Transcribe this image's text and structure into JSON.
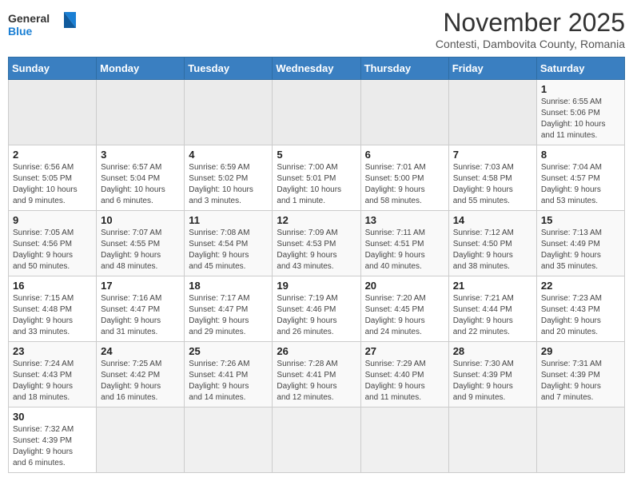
{
  "logo": {
    "text_general": "General",
    "text_blue": "Blue"
  },
  "title": "November 2025",
  "subtitle": "Contesti, Dambovita County, Romania",
  "headers": [
    "Sunday",
    "Monday",
    "Tuesday",
    "Wednesday",
    "Thursday",
    "Friday",
    "Saturday"
  ],
  "weeks": [
    [
      {
        "day": "",
        "info": ""
      },
      {
        "day": "",
        "info": ""
      },
      {
        "day": "",
        "info": ""
      },
      {
        "day": "",
        "info": ""
      },
      {
        "day": "",
        "info": ""
      },
      {
        "day": "",
        "info": ""
      },
      {
        "day": "1",
        "info": "Sunrise: 6:55 AM\nSunset: 5:06 PM\nDaylight: 10 hours\nand 11 minutes."
      }
    ],
    [
      {
        "day": "2",
        "info": "Sunrise: 6:56 AM\nSunset: 5:05 PM\nDaylight: 10 hours\nand 9 minutes."
      },
      {
        "day": "3",
        "info": "Sunrise: 6:57 AM\nSunset: 5:04 PM\nDaylight: 10 hours\nand 6 minutes."
      },
      {
        "day": "4",
        "info": "Sunrise: 6:59 AM\nSunset: 5:02 PM\nDaylight: 10 hours\nand 3 minutes."
      },
      {
        "day": "5",
        "info": "Sunrise: 7:00 AM\nSunset: 5:01 PM\nDaylight: 10 hours\nand 1 minute."
      },
      {
        "day": "6",
        "info": "Sunrise: 7:01 AM\nSunset: 5:00 PM\nDaylight: 9 hours\nand 58 minutes."
      },
      {
        "day": "7",
        "info": "Sunrise: 7:03 AM\nSunset: 4:58 PM\nDaylight: 9 hours\nand 55 minutes."
      },
      {
        "day": "8",
        "info": "Sunrise: 7:04 AM\nSunset: 4:57 PM\nDaylight: 9 hours\nand 53 minutes."
      }
    ],
    [
      {
        "day": "9",
        "info": "Sunrise: 7:05 AM\nSunset: 4:56 PM\nDaylight: 9 hours\nand 50 minutes."
      },
      {
        "day": "10",
        "info": "Sunrise: 7:07 AM\nSunset: 4:55 PM\nDaylight: 9 hours\nand 48 minutes."
      },
      {
        "day": "11",
        "info": "Sunrise: 7:08 AM\nSunset: 4:54 PM\nDaylight: 9 hours\nand 45 minutes."
      },
      {
        "day": "12",
        "info": "Sunrise: 7:09 AM\nSunset: 4:53 PM\nDaylight: 9 hours\nand 43 minutes."
      },
      {
        "day": "13",
        "info": "Sunrise: 7:11 AM\nSunset: 4:51 PM\nDaylight: 9 hours\nand 40 minutes."
      },
      {
        "day": "14",
        "info": "Sunrise: 7:12 AM\nSunset: 4:50 PM\nDaylight: 9 hours\nand 38 minutes."
      },
      {
        "day": "15",
        "info": "Sunrise: 7:13 AM\nSunset: 4:49 PM\nDaylight: 9 hours\nand 35 minutes."
      }
    ],
    [
      {
        "day": "16",
        "info": "Sunrise: 7:15 AM\nSunset: 4:48 PM\nDaylight: 9 hours\nand 33 minutes."
      },
      {
        "day": "17",
        "info": "Sunrise: 7:16 AM\nSunset: 4:47 PM\nDaylight: 9 hours\nand 31 minutes."
      },
      {
        "day": "18",
        "info": "Sunrise: 7:17 AM\nSunset: 4:47 PM\nDaylight: 9 hours\nand 29 minutes."
      },
      {
        "day": "19",
        "info": "Sunrise: 7:19 AM\nSunset: 4:46 PM\nDaylight: 9 hours\nand 26 minutes."
      },
      {
        "day": "20",
        "info": "Sunrise: 7:20 AM\nSunset: 4:45 PM\nDaylight: 9 hours\nand 24 minutes."
      },
      {
        "day": "21",
        "info": "Sunrise: 7:21 AM\nSunset: 4:44 PM\nDaylight: 9 hours\nand 22 minutes."
      },
      {
        "day": "22",
        "info": "Sunrise: 7:23 AM\nSunset: 4:43 PM\nDaylight: 9 hours\nand 20 minutes."
      }
    ],
    [
      {
        "day": "23",
        "info": "Sunrise: 7:24 AM\nSunset: 4:43 PM\nDaylight: 9 hours\nand 18 minutes."
      },
      {
        "day": "24",
        "info": "Sunrise: 7:25 AM\nSunset: 4:42 PM\nDaylight: 9 hours\nand 16 minutes."
      },
      {
        "day": "25",
        "info": "Sunrise: 7:26 AM\nSunset: 4:41 PM\nDaylight: 9 hours\nand 14 minutes."
      },
      {
        "day": "26",
        "info": "Sunrise: 7:28 AM\nSunset: 4:41 PM\nDaylight: 9 hours\nand 12 minutes."
      },
      {
        "day": "27",
        "info": "Sunrise: 7:29 AM\nSunset: 4:40 PM\nDaylight: 9 hours\nand 11 minutes."
      },
      {
        "day": "28",
        "info": "Sunrise: 7:30 AM\nSunset: 4:39 PM\nDaylight: 9 hours\nand 9 minutes."
      },
      {
        "day": "29",
        "info": "Sunrise: 7:31 AM\nSunset: 4:39 PM\nDaylight: 9 hours\nand 7 minutes."
      }
    ],
    [
      {
        "day": "30",
        "info": "Sunrise: 7:32 AM\nSunset: 4:39 PM\nDaylight: 9 hours\nand 6 minutes."
      },
      {
        "day": "",
        "info": ""
      },
      {
        "day": "",
        "info": ""
      },
      {
        "day": "",
        "info": ""
      },
      {
        "day": "",
        "info": ""
      },
      {
        "day": "",
        "info": ""
      },
      {
        "day": "",
        "info": ""
      }
    ]
  ]
}
